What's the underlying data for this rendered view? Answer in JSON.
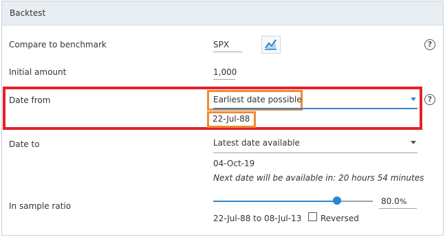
{
  "panel": {
    "title": "Backtest"
  },
  "benchmark": {
    "label": "Compare to benchmark",
    "value": "SPX",
    "icon": "line-chart-icon"
  },
  "initial_amount": {
    "label": "Initial amount",
    "value": "1,000"
  },
  "date_from": {
    "label": "Date from",
    "selected": "Earliest date possible",
    "date": "22-Jul-88"
  },
  "date_to": {
    "label": "Date to",
    "selected": "Latest date available",
    "date": "04-Oct-19",
    "note": "Next date will be available in: 20 hours 54 minutes"
  },
  "in_sample": {
    "label": "In sample ratio",
    "value": "80.0",
    "unit": "%",
    "ratio": 0.8,
    "range": "22-Jul-88 to 08-Jul-13",
    "reversed_label": "Reversed",
    "reversed_checked": false
  },
  "help_glyph": "?",
  "colors": {
    "accent": "#2a86d1",
    "highlight_red": "#e5202a",
    "highlight_orange": "#ef8a31"
  }
}
